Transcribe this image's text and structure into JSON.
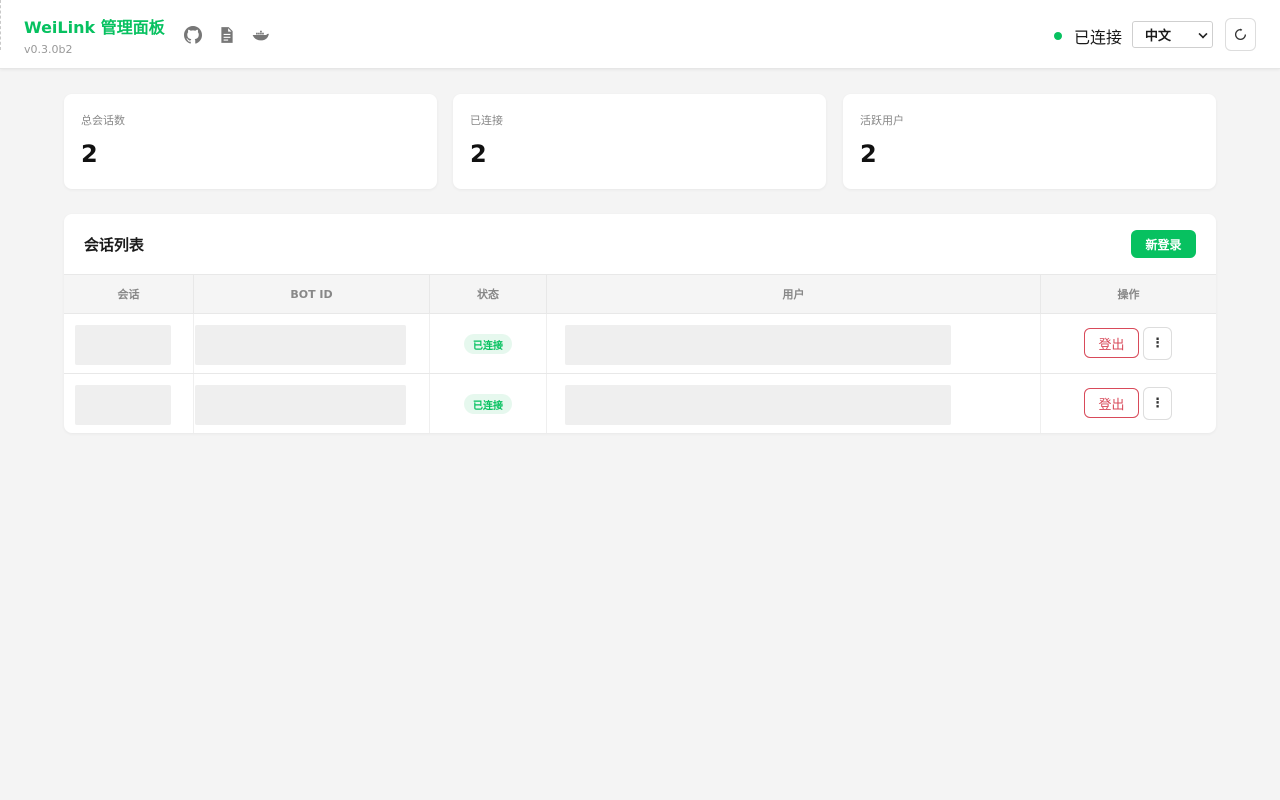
{
  "header": {
    "title": "WeiLink 管理面板",
    "version": "v0.3.0b2",
    "icons": [
      "github-icon",
      "document-icon",
      "docker-icon"
    ],
    "connection_status": "已连接",
    "language": "中文",
    "refresh_icon": "refresh-icon"
  },
  "stats": [
    {
      "label": "总会话数",
      "value": "2"
    },
    {
      "label": "已连接",
      "value": "2"
    },
    {
      "label": "活跃用户",
      "value": "2"
    }
  ],
  "sessions": {
    "title": "会话列表",
    "new_login_label": "新登录",
    "columns": [
      "会话",
      "BOT ID",
      "状态",
      "用户",
      "操作"
    ],
    "rows": [
      {
        "status": "已连接",
        "logout_label": "登出",
        "more_label": "⋮"
      },
      {
        "status": "已连接",
        "logout_label": "登出",
        "more_label": "⋮"
      }
    ]
  },
  "colors": {
    "accent": "#07c160",
    "danger": "#d84a5a",
    "background": "#f4f4f4"
  }
}
